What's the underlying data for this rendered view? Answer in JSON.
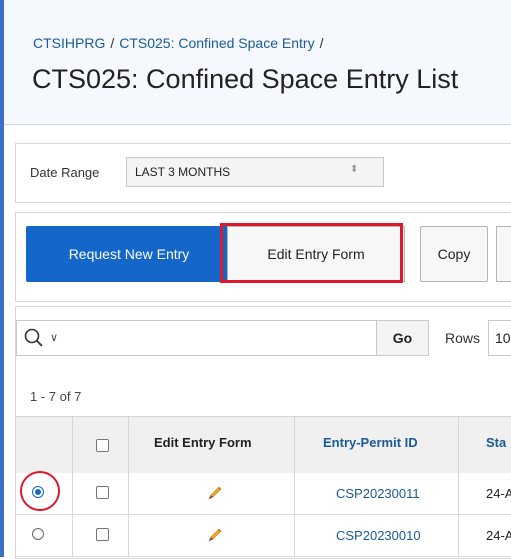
{
  "breadcrumb": {
    "item1": "CTSIHPRG",
    "item2": "CTS025: Confined Space Entry"
  },
  "page": {
    "title": "CTS025: Confined Space Entry List"
  },
  "filters": {
    "date_range_label": "Date Range",
    "date_range_value": "LAST 3 MONTHS"
  },
  "toolbar": {
    "request_new_entry": "Request New Entry",
    "edit_entry_form": "Edit Entry Form",
    "copy": "Copy"
  },
  "report": {
    "go_label": "Go",
    "rows_label": "Rows",
    "rows_value": "10",
    "pagination": "1 - 7 of 7"
  },
  "table": {
    "headers": {
      "edit_entry_form": "Edit Entry Form",
      "entry_permit_id": "Entry-Permit ID",
      "status": "Sta"
    },
    "rows": [
      {
        "selected": true,
        "entry_permit_id": "CSP20230011",
        "date": "24-A"
      },
      {
        "selected": false,
        "entry_permit_id": "CSP20230010",
        "date": "24-A"
      }
    ]
  },
  "colors": {
    "accent": "#1466c8",
    "highlight": "#e0182c",
    "link": "#1a5a96"
  }
}
